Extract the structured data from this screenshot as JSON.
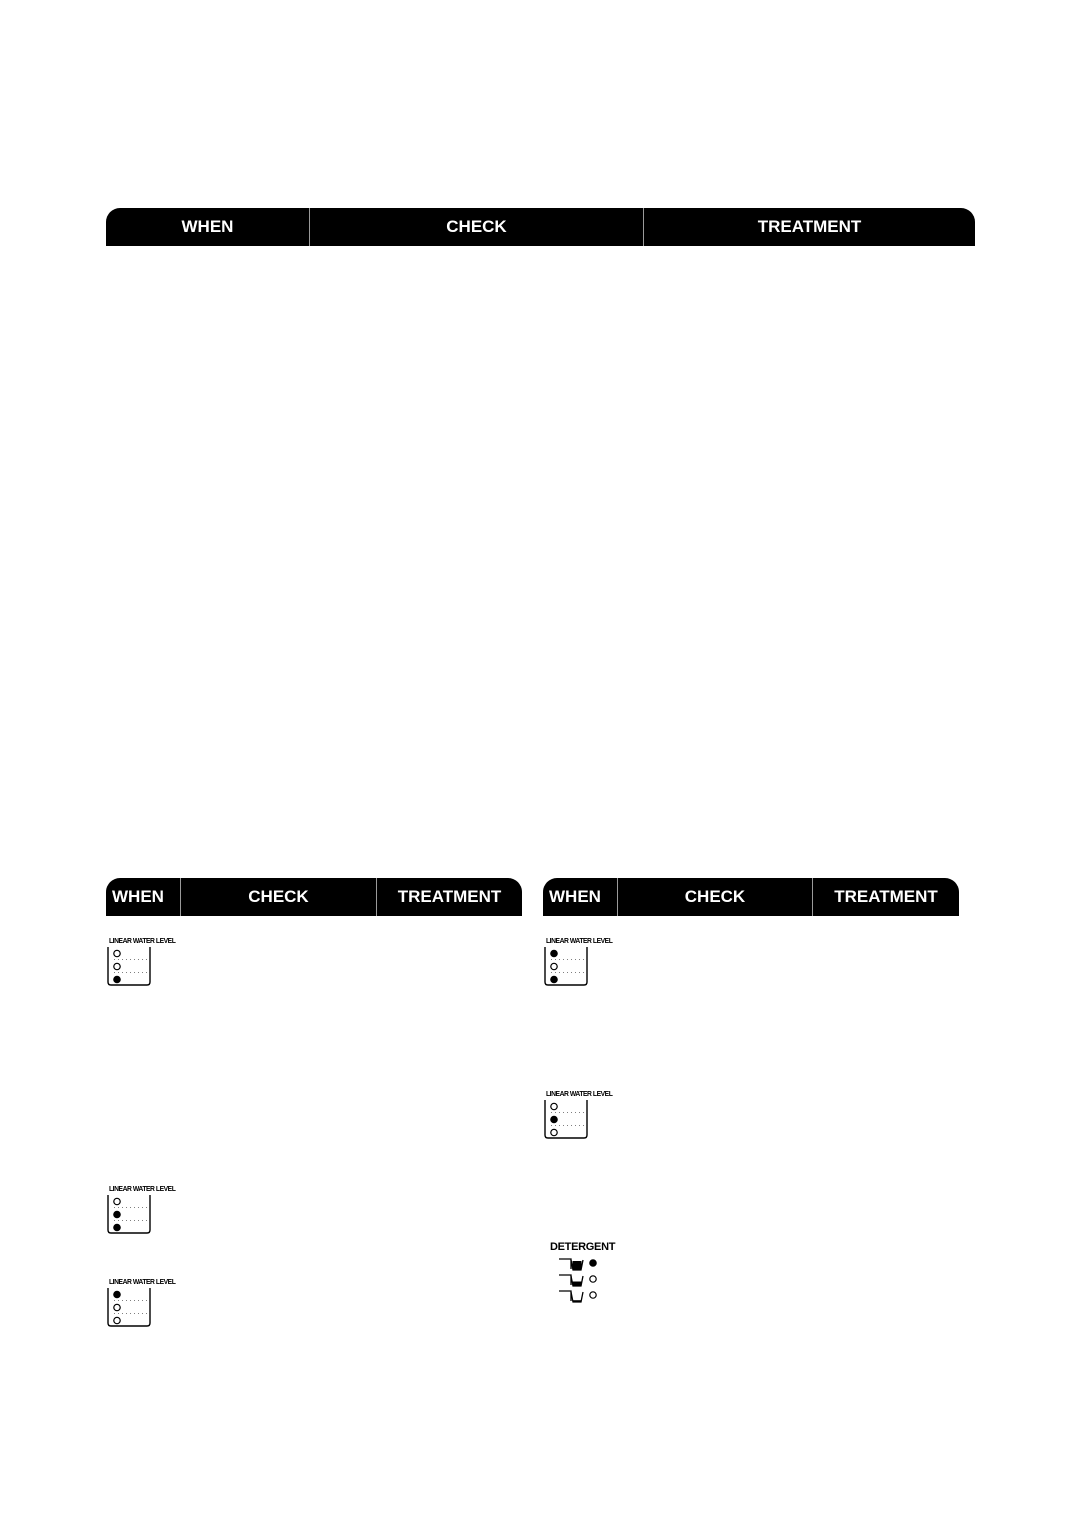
{
  "tables": [
    {
      "id": "top",
      "headers": [
        "WHEN",
        "CHECK",
        "TREATMENT"
      ]
    },
    {
      "id": "bottom-left",
      "headers": [
        "WHEN",
        "CHECK",
        "TREATMENT"
      ]
    },
    {
      "id": "bottom-right",
      "headers": [
        "WHEN",
        "CHECK",
        "TREATMENT"
      ]
    }
  ],
  "indicators": {
    "water_level_label": "LINEAR WATER LEVEL",
    "detergent_label": "DETERGENT",
    "bottom_left": [
      {
        "label": "LINEAR WATER LEVEL",
        "leds": [
          "off",
          "off",
          "on"
        ]
      },
      {
        "label": "LINEAR WATER LEVEL",
        "leds": [
          "off",
          "on",
          "on"
        ]
      },
      {
        "label": "LINEAR WATER LEVEL",
        "leds": [
          "on",
          "off",
          "off"
        ]
      }
    ],
    "bottom_right": [
      {
        "label": "LINEAR WATER LEVEL",
        "leds": [
          "on",
          "off",
          "on"
        ]
      },
      {
        "label": "LINEAR WATER LEVEL",
        "leds": [
          "off",
          "on",
          "off"
        ]
      }
    ],
    "detergent": {
      "label": "DETERGENT",
      "leds": [
        "on",
        "off",
        "off"
      ]
    }
  }
}
